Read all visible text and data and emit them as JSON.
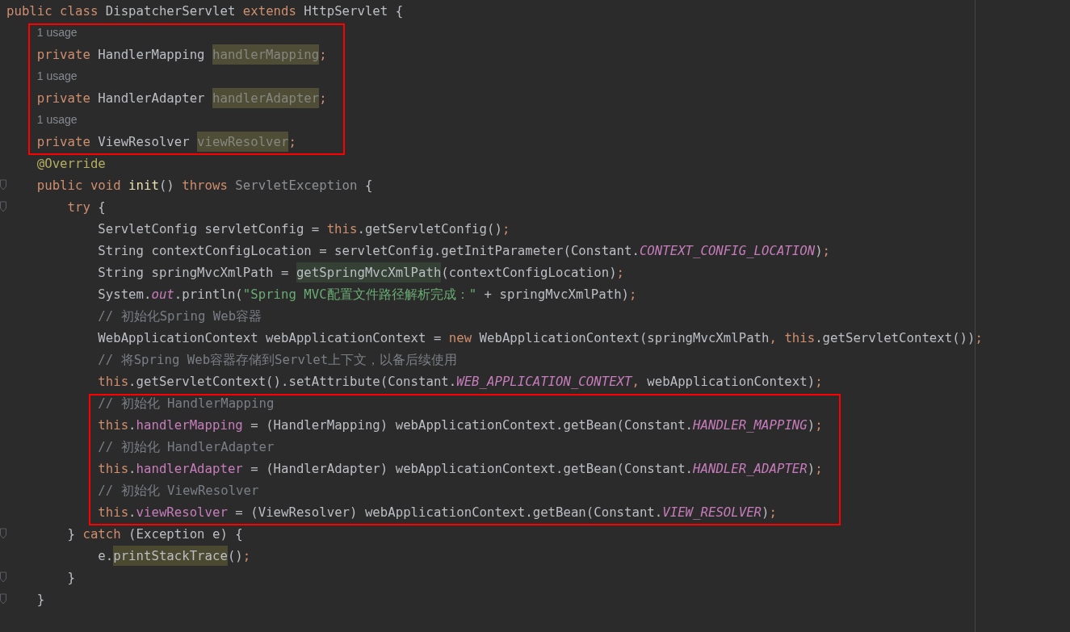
{
  "editor": {
    "lines": [
      {
        "kind": "code",
        "tokens": [
          {
            "text": "public class ",
            "kind": "keyword"
          },
          {
            "text": "DispatcherServlet ",
            "kind": "plain"
          },
          {
            "text": "extends ",
            "kind": "keyword"
          },
          {
            "text": "HttpServlet {",
            "kind": "plain"
          }
        ],
        "children": [
          {
            "kind": "hint",
            "marked": true,
            "text": "1 usage"
          },
          {
            "kind": "code",
            "marked": true,
            "tokens": [
              {
                "text": "private ",
                "kind": "keyword"
              },
              {
                "text": "HandlerMapping ",
                "kind": "plain"
              },
              {
                "text": "handlerMapping",
                "kind": "unused-field"
              },
              {
                "text": ";",
                "kind": "punct"
              }
            ]
          },
          {
            "kind": "hint",
            "marked": true,
            "text": "1 usage"
          },
          {
            "kind": "code",
            "marked": true,
            "tokens": [
              {
                "text": "private ",
                "kind": "keyword"
              },
              {
                "text": "HandlerAdapter ",
                "kind": "plain"
              },
              {
                "text": "handlerAdapter",
                "kind": "unused-field"
              },
              {
                "text": ";",
                "kind": "punct"
              }
            ]
          },
          {
            "kind": "hint",
            "marked": true,
            "text": "1 usage"
          },
          {
            "kind": "code",
            "marked": true,
            "tokens": [
              {
                "text": "private ",
                "kind": "keyword"
              },
              {
                "text": "ViewResolver ",
                "kind": "plain"
              },
              {
                "text": "viewResolver",
                "kind": "unused-field"
              },
              {
                "text": ";",
                "kind": "punct"
              }
            ]
          },
          {
            "kind": "code",
            "tokens": [
              {
                "text": "@Override",
                "kind": "annotation"
              }
            ]
          },
          {
            "kind": "code",
            "fold": true,
            "tokens": [
              {
                "text": "public void ",
                "kind": "keyword"
              },
              {
                "text": "init",
                "kind": "declaration"
              },
              {
                "text": "() ",
                "kind": "plain"
              },
              {
                "text": "throws ",
                "kind": "keyword"
              },
              {
                "text": "ServletException",
                "kind": "dim"
              },
              {
                "text": " {",
                "kind": "plain"
              }
            ],
            "children": [
              {
                "kind": "code",
                "fold": true,
                "tokens": [
                  {
                    "text": "try ",
                    "kind": "keyword"
                  },
                  {
                    "text": "{",
                    "kind": "plain"
                  }
                ],
                "children": [
                  {
                    "kind": "code",
                    "tokens": [
                      {
                        "text": "ServletConfig servletConfig = ",
                        "kind": "plain"
                      },
                      {
                        "text": "this",
                        "kind": "keyword"
                      },
                      {
                        "text": ".getServletConfig()",
                        "kind": "plain"
                      },
                      {
                        "text": ";",
                        "kind": "punct"
                      }
                    ]
                  },
                  {
                    "kind": "code",
                    "tokens": [
                      {
                        "text": "String contextConfigLocation = servletConfig.getInitParameter(Constant.",
                        "kind": "plain"
                      },
                      {
                        "text": "CONTEXT_CONFIG_LOCATION",
                        "kind": "static"
                      },
                      {
                        "text": ")",
                        "kind": "plain"
                      },
                      {
                        "text": ";",
                        "kind": "punct"
                      }
                    ]
                  },
                  {
                    "kind": "code",
                    "tokens": [
                      {
                        "text": "String springMvcXmlPath = ",
                        "kind": "plain"
                      },
                      {
                        "text": "getSpringMvcXmlPath",
                        "kind": "call-highlight"
                      },
                      {
                        "text": "(contextConfigLocation)",
                        "kind": "plain"
                      },
                      {
                        "text": ";",
                        "kind": "punct"
                      }
                    ]
                  },
                  {
                    "kind": "code",
                    "tokens": [
                      {
                        "text": "System.",
                        "kind": "plain"
                      },
                      {
                        "text": "out",
                        "kind": "static"
                      },
                      {
                        "text": ".println(",
                        "kind": "plain"
                      },
                      {
                        "text": "\"Spring MVC配置文件路径解析完成：\"",
                        "kind": "string"
                      },
                      {
                        "text": " + springMvcXmlPath)",
                        "kind": "plain"
                      },
                      {
                        "text": ";",
                        "kind": "punct"
                      }
                    ]
                  },
                  {
                    "kind": "code",
                    "tokens": [
                      {
                        "text": "// 初始化Spring Web容器",
                        "kind": "comment"
                      }
                    ]
                  },
                  {
                    "kind": "code",
                    "tokens": [
                      {
                        "text": "WebApplicationContext webApplicationContext = ",
                        "kind": "plain"
                      },
                      {
                        "text": "new ",
                        "kind": "keyword"
                      },
                      {
                        "text": "WebApplicationContext(springMvcXmlPath",
                        "kind": "plain"
                      },
                      {
                        "text": ", ",
                        "kind": "punct"
                      },
                      {
                        "text": "this",
                        "kind": "keyword"
                      },
                      {
                        "text": ".getServletContext())",
                        "kind": "plain"
                      },
                      {
                        "text": ";",
                        "kind": "punct"
                      }
                    ]
                  },
                  {
                    "kind": "code",
                    "tokens": [
                      {
                        "text": "// 将Spring Web容器存储到Servlet上下文，以备后续使用",
                        "kind": "comment"
                      }
                    ]
                  },
                  {
                    "kind": "code",
                    "tokens": [
                      {
                        "text": "this",
                        "kind": "keyword"
                      },
                      {
                        "text": ".getServletContext().setAttribute(Constant.",
                        "kind": "plain"
                      },
                      {
                        "text": "WEB_APPLICATION_CONTEXT",
                        "kind": "static"
                      },
                      {
                        "text": ", ",
                        "kind": "punct"
                      },
                      {
                        "text": "webApplicationContext)",
                        "kind": "plain"
                      },
                      {
                        "text": ";",
                        "kind": "punct"
                      }
                    ]
                  },
                  {
                    "kind": "code",
                    "marked": true,
                    "tokens": [
                      {
                        "text": "// 初始化 HandlerMapping",
                        "kind": "comment"
                      }
                    ]
                  },
                  {
                    "kind": "code",
                    "marked": true,
                    "tokens": [
                      {
                        "text": "this",
                        "kind": "keyword"
                      },
                      {
                        "text": ".",
                        "kind": "plain"
                      },
                      {
                        "text": "handlerMapping",
                        "kind": "field"
                      },
                      {
                        "text": " = (HandlerMapping) webApplicationContext.getBean(Constant.",
                        "kind": "plain"
                      },
                      {
                        "text": "HANDLER_MAPPING",
                        "kind": "static"
                      },
                      {
                        "text": ")",
                        "kind": "plain"
                      },
                      {
                        "text": ";",
                        "kind": "punct"
                      }
                    ]
                  },
                  {
                    "kind": "code",
                    "marked": true,
                    "tokens": [
                      {
                        "text": "// 初始化 HandlerAdapter",
                        "kind": "comment"
                      }
                    ]
                  },
                  {
                    "kind": "code",
                    "marked": true,
                    "tokens": [
                      {
                        "text": "this",
                        "kind": "keyword"
                      },
                      {
                        "text": ".",
                        "kind": "plain"
                      },
                      {
                        "text": "handlerAdapter",
                        "kind": "field"
                      },
                      {
                        "text": " = (HandlerAdapter) webApplicationContext.getBean(Constant.",
                        "kind": "plain"
                      },
                      {
                        "text": "HANDLER_ADAPTER",
                        "kind": "static"
                      },
                      {
                        "text": ")",
                        "kind": "plain"
                      },
                      {
                        "text": ";",
                        "kind": "punct"
                      }
                    ]
                  },
                  {
                    "kind": "code",
                    "marked": true,
                    "tokens": [
                      {
                        "text": "// 初始化 ViewResolver",
                        "kind": "comment"
                      }
                    ]
                  },
                  {
                    "kind": "code",
                    "marked": true,
                    "tokens": [
                      {
                        "text": "this",
                        "kind": "keyword"
                      },
                      {
                        "text": ".",
                        "kind": "plain"
                      },
                      {
                        "text": "viewResolver",
                        "kind": "field"
                      },
                      {
                        "text": " = (ViewResolver) webApplicationContext.getBean(Constant.",
                        "kind": "plain"
                      },
                      {
                        "text": "VIEW_RESOLVER",
                        "kind": "static"
                      },
                      {
                        "text": ")",
                        "kind": "plain"
                      },
                      {
                        "text": ";",
                        "kind": "punct"
                      }
                    ]
                  }
                ]
              },
              {
                "kind": "code",
                "fold": true,
                "tokens": [
                  {
                    "text": "} ",
                    "kind": "plain"
                  },
                  {
                    "text": "catch ",
                    "kind": "keyword"
                  },
                  {
                    "text": "(Exception e) {",
                    "kind": "plain"
                  }
                ],
                "children": [
                  {
                    "kind": "code",
                    "tokens": [
                      {
                        "text": "e.",
                        "kind": "plain"
                      },
                      {
                        "text": "printStackTrace",
                        "kind": "read-highlight"
                      },
                      {
                        "text": "()",
                        "kind": "plain"
                      },
                      {
                        "text": ";",
                        "kind": "punct"
                      }
                    ]
                  }
                ]
              },
              {
                "kind": "code",
                "fold": true,
                "tokens": [
                  {
                    "text": "}",
                    "kind": "plain"
                  }
                ]
              }
            ]
          },
          {
            "kind": "code",
            "fold": true,
            "tokens": [
              {
                "text": "}",
                "kind": "plain"
              }
            ]
          }
        ]
      }
    ]
  }
}
